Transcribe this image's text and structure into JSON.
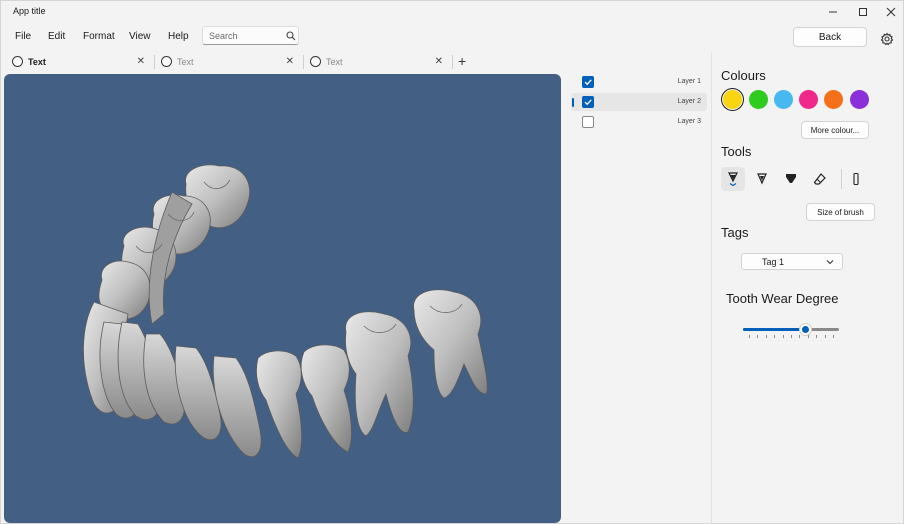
{
  "window": {
    "title": "App title"
  },
  "menu": [
    "File",
    "Edit",
    "Format",
    "View",
    "Help"
  ],
  "search": {
    "placeholder": "Search"
  },
  "header": {
    "back_label": "Back"
  },
  "tabs": [
    {
      "label": "Text",
      "active": true
    },
    {
      "label": "Text",
      "active": false
    },
    {
      "label": "Text",
      "active": false
    }
  ],
  "layers": [
    {
      "label": "Layer 1",
      "checked": true,
      "selected": false
    },
    {
      "label": "Layer 2",
      "checked": true,
      "selected": true
    },
    {
      "label": "Layer 3",
      "checked": false,
      "selected": false
    }
  ],
  "colours": {
    "title": "Colours",
    "swatches": [
      "#f8d412",
      "#2ecc1e",
      "#48b8f0",
      "#f0288c",
      "#f6701c",
      "#8a2fd9"
    ],
    "selected_index": 0,
    "more_label": "More colour..."
  },
  "tools": {
    "title": "Tools",
    "items": [
      "pen-dropdown-icon",
      "pen-icon",
      "highlighter-icon",
      "eraser-icon",
      "ruler-icon"
    ],
    "brush_label": "Size of brush"
  },
  "tags": {
    "title": "Tags",
    "selected": "Tag 1"
  },
  "wear": {
    "title": "Tooth Wear Degree",
    "value_fraction": 0.65
  },
  "theme": {
    "accent": "#005fb8",
    "viewport_bg": "#445f84"
  }
}
